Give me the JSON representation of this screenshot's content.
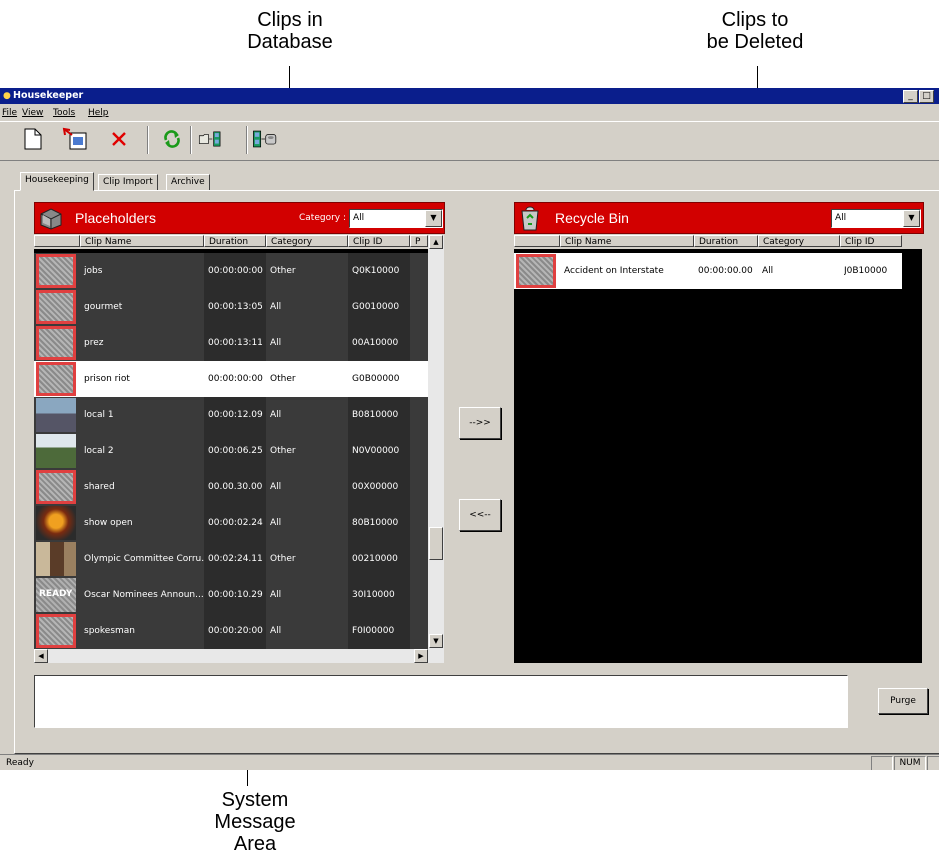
{
  "callouts": {
    "clips_in_db": [
      "Clips in",
      "Database"
    ],
    "clips_to_delete": [
      "Clips to",
      "be Deleted"
    ],
    "system_message": [
      "System",
      "Message",
      "Area"
    ]
  },
  "window": {
    "title": "Housekeeper",
    "controls": [
      "_",
      "□"
    ]
  },
  "menu": [
    "File",
    "View",
    "Tools",
    "Help"
  ],
  "toolbar": {
    "buttons": [
      "new-icon",
      "import-icon",
      "delete-icon",
      "refresh-icon",
      "folder-to-clip-icon",
      "clip-to-archive-icon"
    ]
  },
  "tabs": [
    "Housekeeping",
    "Clip Import",
    "Archive"
  ],
  "placeholders": {
    "title": "Placeholders",
    "category_label": "Category :",
    "category_value": "All",
    "columns": [
      "Clip Name",
      "Duration",
      "Category",
      "Clip ID",
      "P"
    ],
    "rows": [
      {
        "name": "jobs",
        "duration": "00:00:00:00",
        "category": "Other",
        "id": "Q0K10000",
        "thumb": "static",
        "selected": false
      },
      {
        "name": "gourmet",
        "duration": "00:00:13:05",
        "category": "All",
        "id": "G0010000",
        "thumb": "static",
        "selected": false
      },
      {
        "name": "prez",
        "duration": "00:00:13:11",
        "category": "All",
        "id": "00A10000",
        "thumb": "static",
        "selected": false
      },
      {
        "name": "prison riot",
        "duration": "00:00:00:00",
        "category": "Other",
        "id": "G0B00000",
        "thumb": "static",
        "selected": true
      },
      {
        "name": "local 1",
        "duration": "00:00:12.09",
        "category": "All",
        "id": "B0810000",
        "thumb": "photo-street",
        "selected": false
      },
      {
        "name": "local 2",
        "duration": "00:00:06.25",
        "category": "Other",
        "id": "N0V00000",
        "thumb": "photo-tanks",
        "selected": false
      },
      {
        "name": "shared",
        "duration": "00.00.30.00",
        "category": "All",
        "id": "00X00000",
        "thumb": "static",
        "selected": false
      },
      {
        "name": "show open",
        "duration": "00:00:02.24",
        "category": "All",
        "id": "80B10000",
        "thumb": "photo-fire",
        "selected": false
      },
      {
        "name": "Olympic Committee Corru...",
        "duration": "00:02:24.11",
        "category": "Other",
        "id": "00210000",
        "thumb": "photo-people",
        "selected": false
      },
      {
        "name": "Oscar Nominees Announ...",
        "duration": "00:00:10.29",
        "category": "All",
        "id": "30I10000",
        "thumb": "ready",
        "thumb_text": "READY",
        "selected": false
      },
      {
        "name": "spokesman",
        "duration": "00:00:20:00",
        "category": "All",
        "id": "F0I00000",
        "thumb": "static",
        "selected": false
      }
    ]
  },
  "recycle": {
    "title": "Recycle Bin",
    "filter_value": "All",
    "columns": [
      "Clip Name",
      "Duration",
      "Category",
      "Clip ID"
    ],
    "rows": [
      {
        "name": "Accident on Interstate",
        "duration": "00:00:00.00",
        "category": "All",
        "id": "J0B10000"
      }
    ]
  },
  "transfer": {
    "to_recycle": "-->>",
    "to_placeholders": "<<--"
  },
  "purge_label": "Purge",
  "status": {
    "text": "Ready",
    "num": "NUM"
  },
  "colors": {
    "header_red": "#d20000",
    "title_blue": "#0a1e8c",
    "row_dark": "#3a3a3a",
    "static_border": "#e04040"
  }
}
